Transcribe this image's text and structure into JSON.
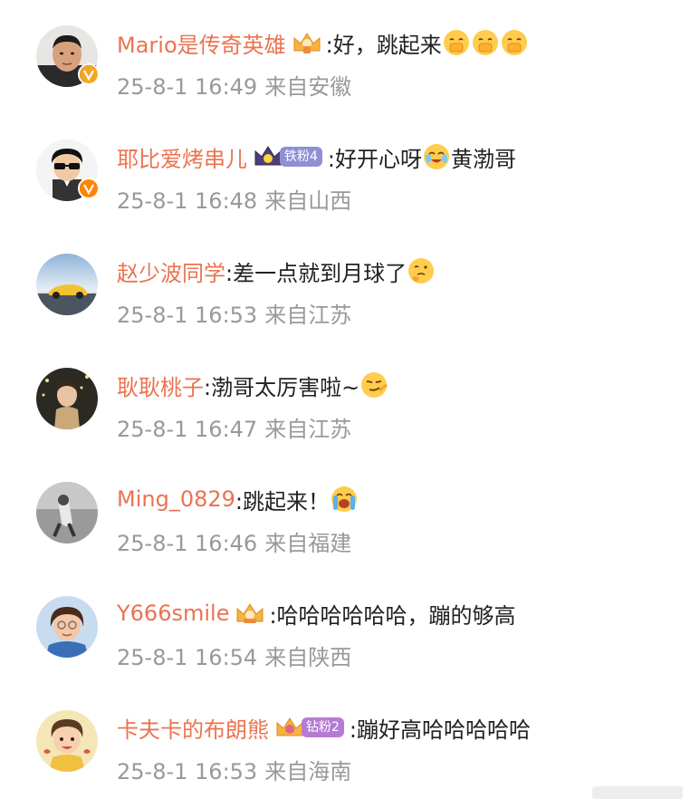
{
  "comments": [
    {
      "username": "Mario是传奇英雄",
      "has_badge_crown": true,
      "fan_badge": "",
      "text_parts": [
        ":好，跳起来"
      ],
      "emojis": [
        "shy-emoji",
        "shy-emoji",
        "shy-emoji"
      ],
      "text_after": "",
      "date": "25-8-1 16:49",
      "location": "来自安徽",
      "verify_color": "#f5a623",
      "avatar_desc": "man-photo"
    },
    {
      "username": "耶比爱烤串儿",
      "has_badge_crown": true,
      "fan_badge": "铁粉4",
      "text_parts": [
        ":好开心呀"
      ],
      "emojis": [
        "happy-cry-emoji"
      ],
      "text_after": "黄渤哥",
      "date": "25-8-1 16:48",
      "location": "来自山西",
      "verify_color": "#ff8200",
      "avatar_desc": "cartoon-sunglasses"
    },
    {
      "username": "赵少波同学",
      "has_badge_crown": false,
      "fan_badge": "",
      "text_parts": [
        ":差一点就到月球了"
      ],
      "emojis": [
        "thinking-emoji"
      ],
      "text_after": "",
      "date": "25-8-1 16:53",
      "location": "来自江苏",
      "verify_color": "",
      "avatar_desc": "car-photo"
    },
    {
      "username": "耿耿桃子",
      "has_badge_crown": false,
      "fan_badge": "",
      "text_parts": [
        ":渤哥太厉害啦~"
      ],
      "emojis": [
        "smug-emoji"
      ],
      "text_after": "",
      "date": "25-8-1 16:47",
      "location": "来自江苏",
      "verify_color": "",
      "avatar_desc": "girl-lights"
    },
    {
      "username": "Ming_0829",
      "has_badge_crown": false,
      "fan_badge": "",
      "text_parts": [
        ":跳起来！"
      ],
      "emojis": [
        "tears-joy-emoji"
      ],
      "text_after": "",
      "date": "25-8-1 16:46",
      "location": "来自福建",
      "verify_color": "",
      "avatar_desc": "figure-grey"
    },
    {
      "username": "Y666smile",
      "has_badge_crown": true,
      "fan_badge": "",
      "text_parts": [
        ":哈哈哈哈哈哈，蹦的够高"
      ],
      "emojis": [],
      "text_after": "",
      "date": "25-8-1 16:54",
      "location": "来自陕西",
      "verify_color": "",
      "avatar_desc": "woman-glasses"
    },
    {
      "username": "卡夫卡的布朗熊",
      "has_badge_crown": true,
      "fan_badge": "钻粉2",
      "text_parts": [
        ":蹦好高哈哈哈哈哈"
      ],
      "emojis": [],
      "text_after": "",
      "date": "25-8-1 16:53",
      "location": "来自海南",
      "verify_color": "",
      "avatar_desc": "cartoon-boy"
    }
  ],
  "colors": {
    "username": "#eb7350",
    "text": "#222222",
    "meta": "#999999",
    "iron_fan": "#8f8fd6",
    "diamond_fan": "#b57ad6"
  }
}
